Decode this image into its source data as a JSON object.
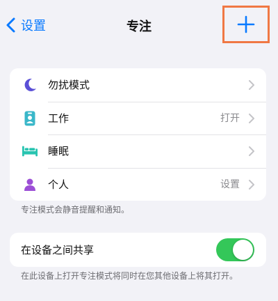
{
  "navbar": {
    "back_label": "设置",
    "title": "专注",
    "add_symbol": "+"
  },
  "focus_modes": [
    {
      "label": "勿扰模式",
      "value": "",
      "icon": "moon-icon",
      "color": "#5a4fd6"
    },
    {
      "label": "工作",
      "value": "打开",
      "icon": "id-badge-icon",
      "color": "#3ab7c9"
    },
    {
      "label": "睡眠",
      "value": "",
      "icon": "bed-icon",
      "color": "#28c4b0"
    },
    {
      "label": "个人",
      "value": "设置",
      "icon": "person-icon",
      "color": "#9c4fd6"
    }
  ],
  "focus_footer": "专注模式会静音提醒和通知。",
  "share": {
    "label": "在设备之间共享",
    "enabled": true,
    "footer": "在此设备上打开专注模式将同时在您其他设备上将其打开。"
  },
  "colors": {
    "accent": "#0a7aff",
    "highlight_box": "#f07844",
    "toggle_on": "#34c759"
  }
}
